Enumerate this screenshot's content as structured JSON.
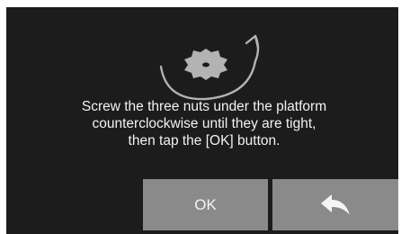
{
  "message": {
    "lines": [
      "Screw the three nuts under the platform",
      "counterclockwise until they are tight,",
      "then tap the [OK] button."
    ]
  },
  "buttons": {
    "ok_label": "OK",
    "back_icon": "back-arrow-icon"
  },
  "colors": {
    "screen_background": "#1c1c1c",
    "button_background": "#8a8a8a",
    "text": "#f2f2f2",
    "illustration": "#b3b3b3"
  }
}
